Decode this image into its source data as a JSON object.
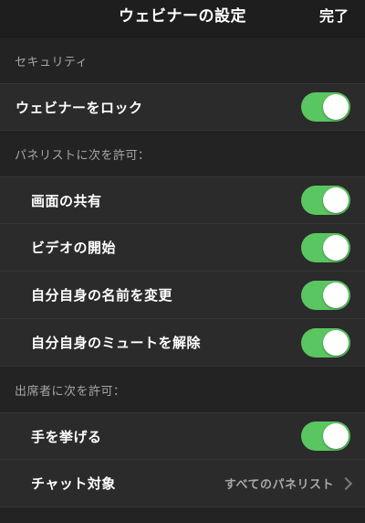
{
  "navbar": {
    "title": "ウェビナーの設定",
    "done_label": "完了"
  },
  "security": {
    "header": "セキュリティ",
    "lock_label": "ウェビナーをロック",
    "lock_on": true
  },
  "panelists": {
    "header": "パネリストに次を許可：",
    "items": [
      {
        "label": "画面の共有",
        "on": true
      },
      {
        "label": "ビデオの開始",
        "on": true
      },
      {
        "label": "自分自身の名前を変更",
        "on": true
      },
      {
        "label": "自分自身のミュートを解除",
        "on": true
      }
    ]
  },
  "attendees": {
    "header": "出席者に次を許可：",
    "raise_hand_label": "手を挙げる",
    "raise_hand_on": true,
    "chat_label": "チャット対象",
    "chat_value": "すべてのパネリスト"
  },
  "colors": {
    "toggle_on": "#5ac661",
    "background": "#232323",
    "row_background": "#2b2b2b"
  },
  "icons": {
    "chevron": "chevron-right-icon"
  }
}
